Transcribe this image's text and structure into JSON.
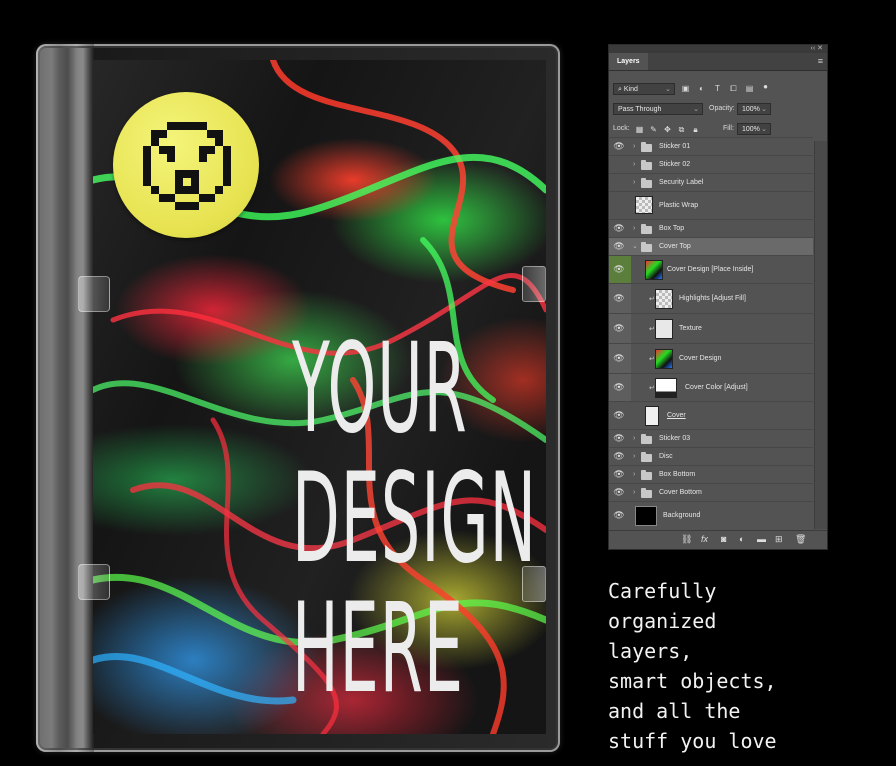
{
  "colors": {
    "background": "#000000",
    "panel": "#535353",
    "panel_dark": "#424242",
    "selected_row": "#6a6a6a",
    "active_eye": "#5b7e3c",
    "sticker_yellow": "#e6e24f",
    "cover_text": "#ececec"
  },
  "cover": {
    "lines": [
      "YOUR",
      "DESIGN",
      "HERE"
    ],
    "sticker_icon": "pixel-shocked-face-icon"
  },
  "panel": {
    "tab": "Layers",
    "filter_kind": "Kind",
    "blend_mode": "Pass Through",
    "opacity_label": "Opacity:",
    "opacity_value": "100%",
    "lock_label": "Lock:",
    "fill_label": "Fill:",
    "fill_value": "100%",
    "layers": [
      {
        "name": "Sticker 01",
        "visible": true,
        "type": "group"
      },
      {
        "name": "Sticker 02",
        "visible": false,
        "type": "group"
      },
      {
        "name": "Security Label",
        "visible": false,
        "type": "group"
      },
      {
        "name": "Plastic Wrap",
        "visible": false,
        "type": "layer"
      },
      {
        "name": "Box Top",
        "visible": true,
        "type": "group"
      },
      {
        "name": "Cover Top",
        "visible": true,
        "type": "group",
        "expanded": true,
        "selected": true
      },
      {
        "name": "Cover Design [Place Inside]",
        "visible": true,
        "type": "smart"
      },
      {
        "name": "Highlights [Adjust Fill]",
        "visible": true,
        "type": "clipped"
      },
      {
        "name": "Texture",
        "visible": true,
        "type": "clipped"
      },
      {
        "name": "Cover Design",
        "visible": true,
        "type": "clipped"
      },
      {
        "name": "Cover Color [Adjust]",
        "visible": true,
        "type": "clipped"
      },
      {
        "name": "Cover",
        "visible": true,
        "type": "layer"
      },
      {
        "name": "Sticker 03",
        "visible": true,
        "type": "group"
      },
      {
        "name": "Disc",
        "visible": true,
        "type": "group"
      },
      {
        "name": "Box Bottom",
        "visible": true,
        "type": "group"
      },
      {
        "name": "Cover Bottom",
        "visible": true,
        "type": "group"
      },
      {
        "name": "Background",
        "visible": true,
        "type": "layer"
      }
    ]
  },
  "caption": {
    "lines": [
      "Carefully",
      "organized",
      "layers,",
      "smart objects,",
      "and all the",
      "stuff you love"
    ]
  }
}
